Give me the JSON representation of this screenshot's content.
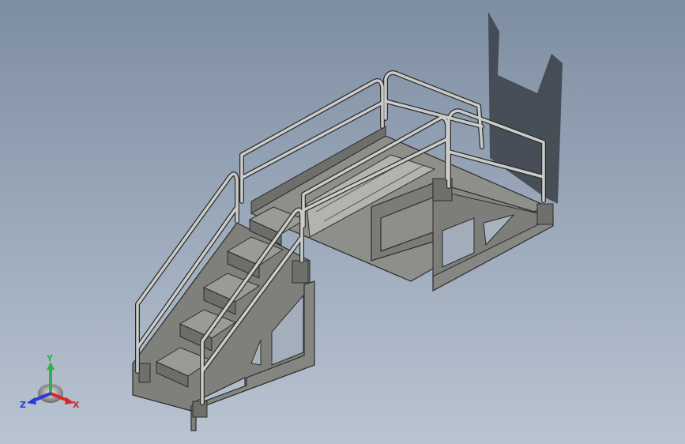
{
  "viewport": {
    "background_top": "#7e8ea2",
    "background_bottom": "#b9c4d1"
  },
  "model": {
    "steel_color": "#8a8a86",
    "rail_color": "#c9ccc8",
    "edge_color": "#2c2c2c",
    "shadow_color": "#3a3f46"
  },
  "triad": {
    "x_label": "X",
    "y_label": "Y",
    "z_label": "Z",
    "x_color": "#d8262a",
    "y_color": "#2bb24a",
    "z_color": "#2a3ad8"
  }
}
